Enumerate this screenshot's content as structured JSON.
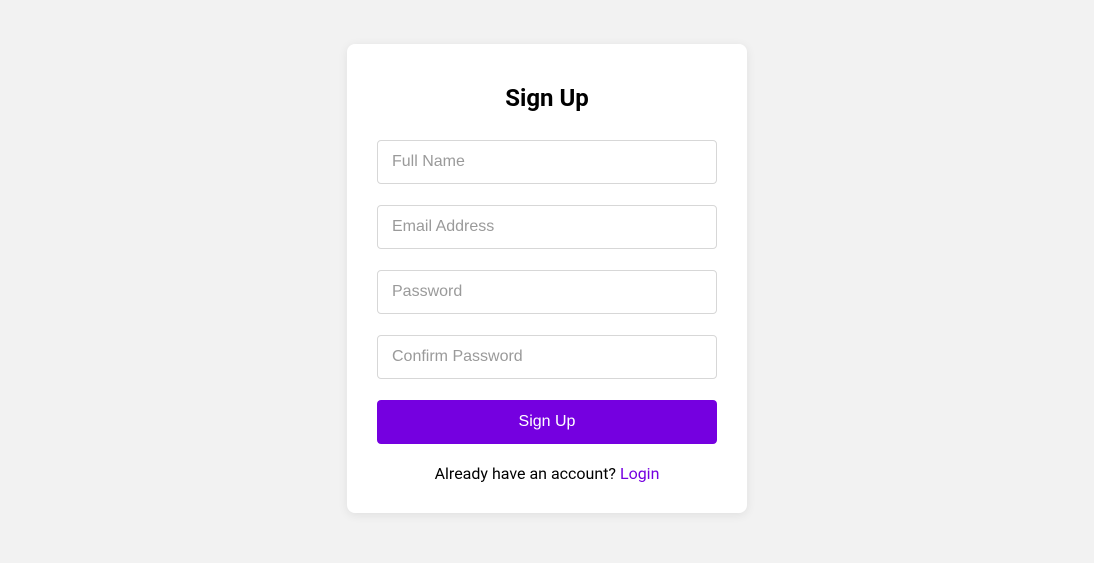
{
  "form": {
    "title": "Sign Up",
    "fields": {
      "fullName": {
        "placeholder": "Full Name",
        "value": ""
      },
      "email": {
        "placeholder": "Email Address",
        "value": ""
      },
      "password": {
        "placeholder": "Password",
        "value": ""
      },
      "confirmPassword": {
        "placeholder": "Confirm Password",
        "value": ""
      }
    },
    "submitLabel": "Sign Up",
    "footer": {
      "prompt": "Already have an account? ",
      "linkLabel": "Login"
    }
  },
  "colors": {
    "accent": "#7500e0",
    "background": "#f2f2f2",
    "cardBackground": "#ffffff"
  }
}
